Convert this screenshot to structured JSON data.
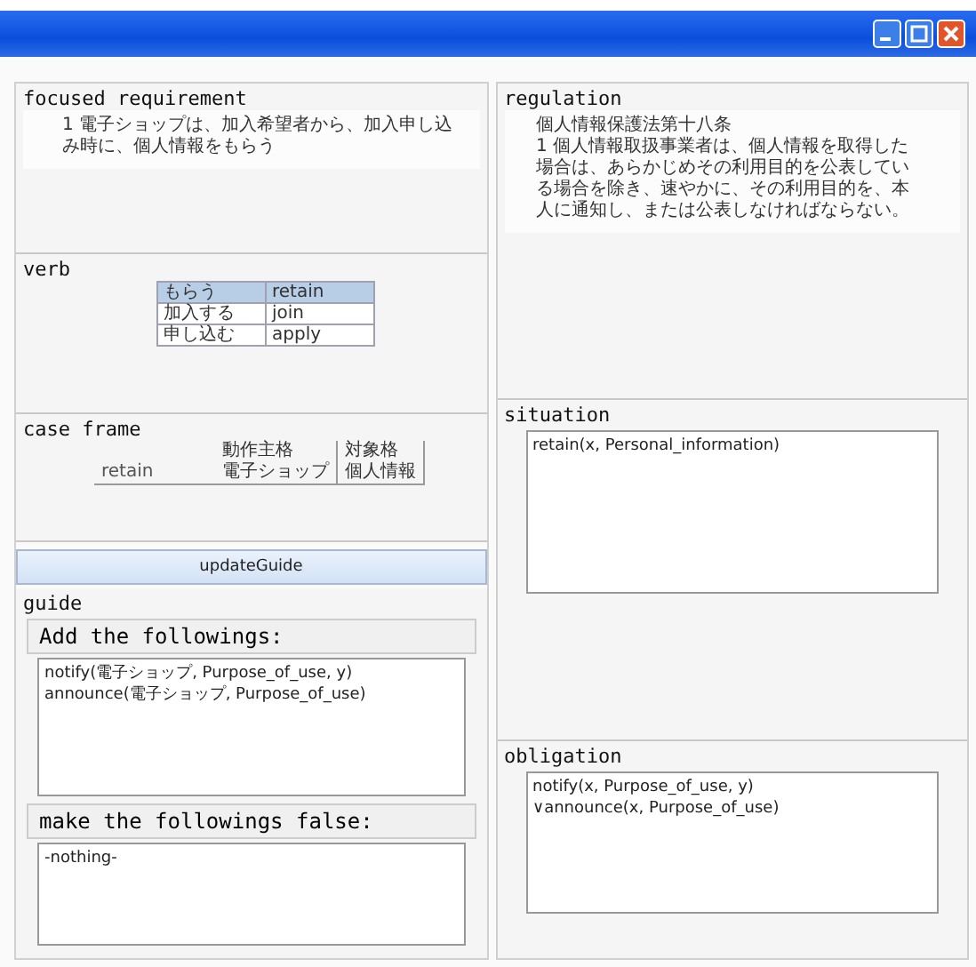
{
  "window": {
    "controls": [
      {
        "kind": "minimize"
      },
      {
        "kind": "maximize"
      },
      {
        "kind": "close"
      }
    ]
  },
  "focused_requirement": {
    "title": "focused requirement",
    "text": "1 電子ショップは、加入希望者から、加入申し込み時に、個人情報をもらう"
  },
  "verb": {
    "title": "verb",
    "rows": [
      {
        "cells": [
          "もらう",
          "retain"
        ],
        "selected": true
      },
      {
        "cells": [
          "加入する",
          "join"
        ],
        "selected": false
      },
      {
        "cells": [
          "申し込む",
          "apply"
        ],
        "selected": false
      }
    ]
  },
  "case_frame": {
    "title": "case frame",
    "columns": [
      "動作主格",
      "対象格"
    ],
    "rows": [
      {
        "verb": "retain",
        "cells": [
          "電子ショップ",
          "個人情報"
        ]
      }
    ]
  },
  "update_button": "updateGuide",
  "guide": {
    "title": "guide",
    "add_title": "Add the followings:",
    "add_lines": [
      "notify(電子ショップ, Purpose_of_use, y)",
      "announce(電子ショップ, Purpose_of_use)"
    ],
    "false_title": "make the followings false:",
    "false_lines": [
      "-nothing-"
    ]
  },
  "regulation": {
    "title": "regulation",
    "lines": [
      "個人情報保護法第十八条",
      "1 個人情報取扱事業者は、個人情報を取得した場合は、あらかじめその利用目的を公表している場合を除き、速やかに、その利用目的を、本人に通知し、または公表しなければならない。"
    ]
  },
  "situation": {
    "title": "situation",
    "lines": [
      "retain(x, Personal_information)"
    ]
  },
  "obligation": {
    "title": "obligation",
    "lines": [
      "notify(x, Purpose_of_use, y)",
      "∨announce(x, Purpose_of_use)"
    ]
  }
}
